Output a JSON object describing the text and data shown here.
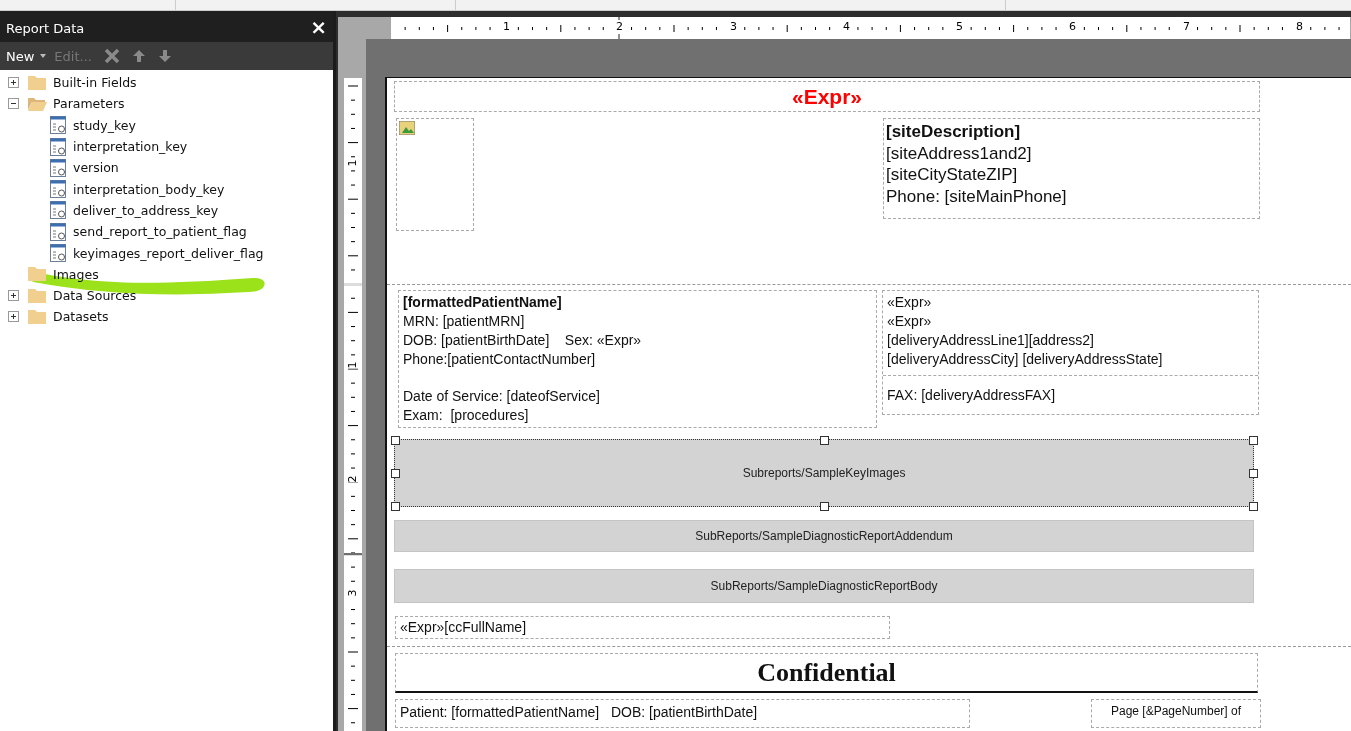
{
  "panel": {
    "title": "Report Data",
    "close": "×",
    "toolbar": [
      {
        "label": "New",
        "disabled": false,
        "dropdown": true
      },
      {
        "label": "Edit...",
        "disabled": true,
        "dropdown": false
      }
    ],
    "tree": [
      {
        "label": "Built-in Fields",
        "kind": "folder",
        "expanded": false
      },
      {
        "label": "Parameters",
        "kind": "folder",
        "expanded": true,
        "children": [
          {
            "label": "study_key",
            "kind": "parameter"
          },
          {
            "label": "interpretation_key",
            "kind": "parameter"
          },
          {
            "label": "version",
            "kind": "parameter"
          },
          {
            "label": "interpretation_body_key",
            "kind": "parameter"
          },
          {
            "label": "deliver_to_address_key",
            "kind": "parameter"
          },
          {
            "label": "send_report_to_patient_flag",
            "kind": "parameter"
          },
          {
            "label": "keyimages_report_deliver_flag",
            "kind": "parameter"
          }
        ]
      },
      {
        "label": "Images",
        "kind": "empty-folder"
      },
      {
        "label": "Data Sources",
        "kind": "folder",
        "expanded": false
      },
      {
        "label": "Datasets",
        "kind": "folder",
        "expanded": false
      }
    ]
  },
  "h_ruler": [
    "1",
    "2",
    "3",
    "4",
    "5",
    "6",
    "7",
    "8"
  ],
  "v_ruler": [
    "1",
    "1",
    "2",
    "3"
  ],
  "report": {
    "title": "«Expr»",
    "site": {
      "name": "[siteDescription]",
      "lines": [
        "[siteAddress1and2]",
        "[siteCityStateZIP]",
        "Phone: [siteMainPhone]"
      ]
    },
    "patient": {
      "name": "[formattedPatientName]",
      "lines": [
        "MRN: [patientMRN]",
        "DOB: [patientBirthDate]    Sex: «Expr»",
        "Phone:[patientContactNumber]"
      ],
      "service_lines": [
        "Date of Service: [dateofService]",
        "Exam:  [procedures]"
      ]
    },
    "delivery": {
      "lines": [
        "«Expr»",
        "«Expr»",
        "[deliveryAddressLine1][address2]",
        "[deliveryAddressCity] [deliveryAddressState]"
      ],
      "fax": "FAX: [deliveryAddressFAX]"
    },
    "subreports": [
      {
        "label": "Subreports/SampleKeyImages",
        "selected": true
      },
      {
        "label": "SubReports/SampleDiagnosticReportAddendum",
        "selected": false
      },
      {
        "label": "SubReports/SampleDiagnosticReportBody",
        "selected": false
      }
    ],
    "cc_line": "«Expr»[ccFullName]",
    "confidential": "Confidential",
    "footer_patient": "Patient: [formattedPatientName]   DOB: [patientBirthDate]",
    "footer_page": "Page [&PageNumber] of"
  }
}
